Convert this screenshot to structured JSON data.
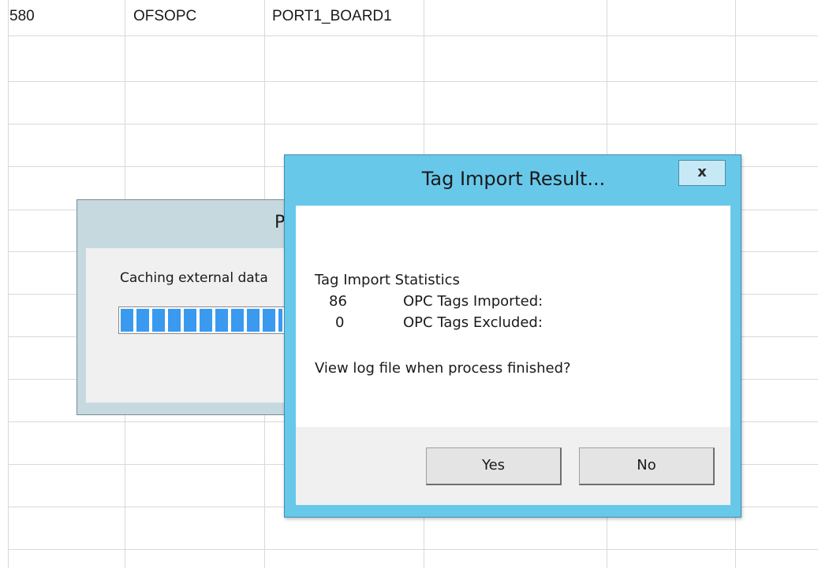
{
  "spreadsheet": {
    "row1": [
      "580",
      "OFSOPC",
      "PORT1_BOARD1"
    ]
  },
  "progress_dialog": {
    "title_fragment": "P",
    "message": "Caching external data",
    "progress_fraction": 0.8
  },
  "result_dialog": {
    "title": "Tag Import Result...",
    "close_glyph": "x",
    "stats_heading": "Tag Import Statistics",
    "stats": [
      {
        "count": "86",
        "label": "OPC Tags Imported:"
      },
      {
        "count": "0",
        "label": "OPC Tags Excluded:"
      }
    ],
    "question": "View log file when process finished?",
    "yes_label": "Yes",
    "no_label": "No"
  },
  "colors": {
    "dialog_frame": "#68c8ea",
    "progress_fill": "#3a9af0",
    "gridline": "#d9d9d9"
  }
}
